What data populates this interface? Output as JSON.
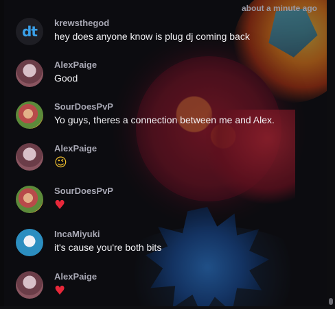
{
  "chat": {
    "timestamp": "about a minute ago",
    "messages": [
      {
        "user": "krewsthegod",
        "text": "hey does anyone know is plug dj coming back",
        "avatar": "dt"
      },
      {
        "user": "AlexPaige",
        "text": "Good"
      },
      {
        "user": "SourDoesPvP",
        "text": "Yo guys, theres a connection between me and Alex."
      },
      {
        "user": "AlexPaige",
        "emoji": "😉"
      },
      {
        "user": "SourDoesPvP",
        "emoji": "♥"
      },
      {
        "user": "IncaMiyuki",
        "text": "it's cause you're both bits"
      },
      {
        "user": "AlexPaige",
        "emoji": "♥"
      }
    ]
  },
  "colors": {
    "background": "#0f0f12",
    "username": "#a8a8b4",
    "message_text": "#f2f2f5",
    "timestamp": "#9a9aa6",
    "heart": "#e8283a"
  },
  "icons": {
    "krewsthegod_avatar": "dt-logo-icon",
    "heart": "heart-emoji",
    "wink": "winking-face-emoji"
  }
}
